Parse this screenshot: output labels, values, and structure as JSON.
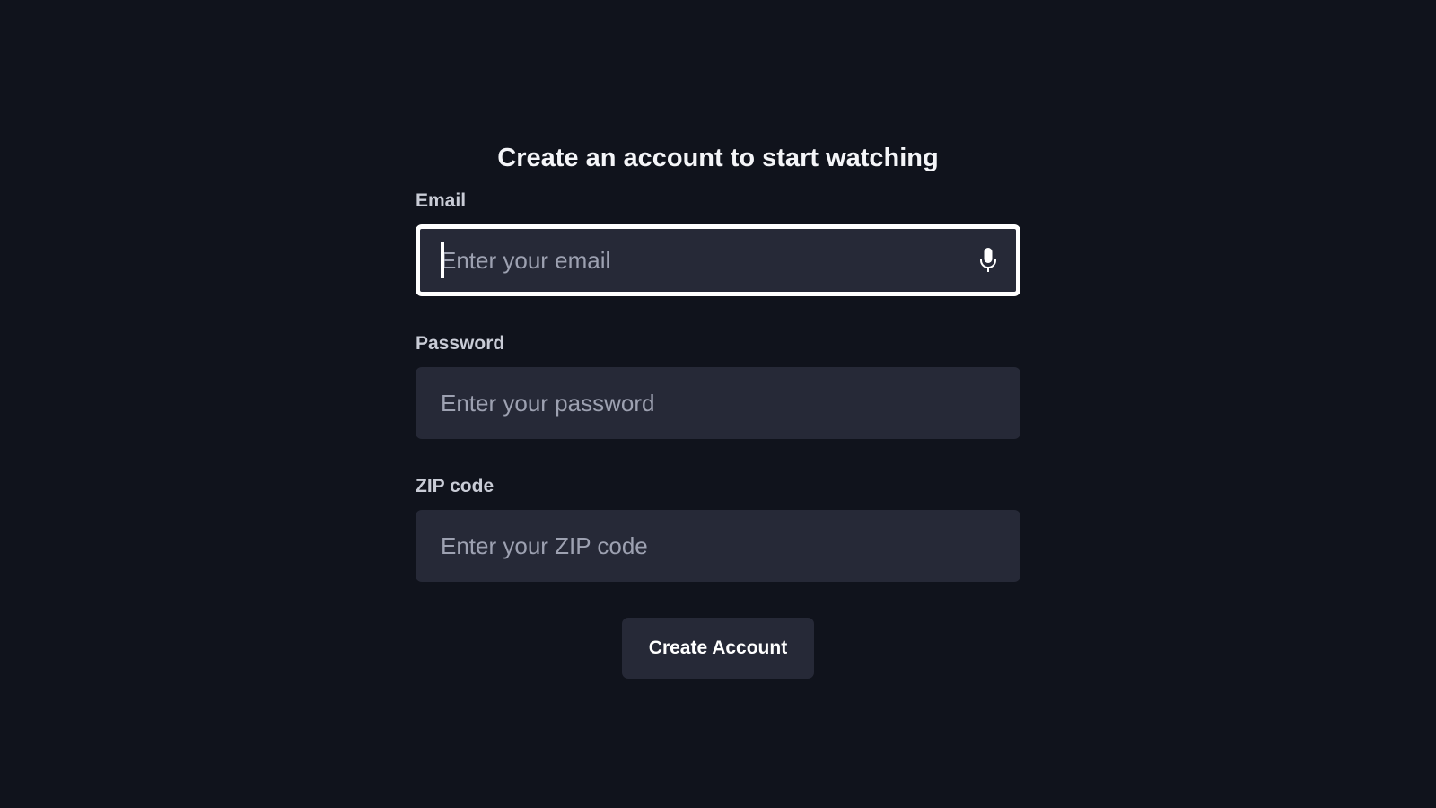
{
  "form": {
    "title": "Create an account to start watching",
    "email": {
      "label": "Email",
      "placeholder": "Enter your email",
      "value": "",
      "icon": "microphone-icon",
      "focused": true
    },
    "password": {
      "label": "Password",
      "placeholder": "Enter your password",
      "value": ""
    },
    "zip": {
      "label": "ZIP code",
      "placeholder": "Enter your ZIP code",
      "value": ""
    },
    "submit_label": "Create Account"
  },
  "colors": {
    "background": "#10131c",
    "input_background": "#262937",
    "focus_border": "#ffffff",
    "label_text": "#c9ccd6",
    "placeholder_text": "#9da1b1"
  }
}
